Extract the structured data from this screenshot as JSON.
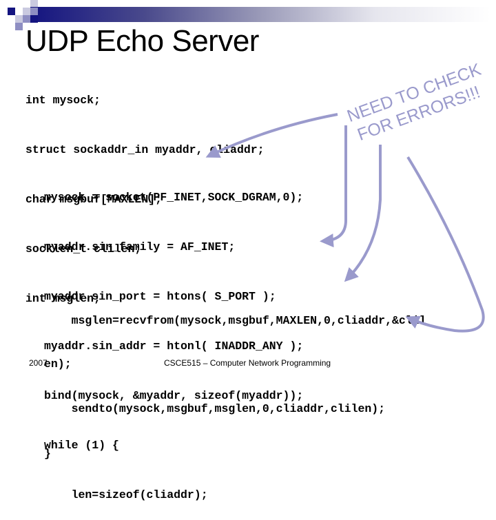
{
  "slide": {
    "title": "UDP Echo Server",
    "declarations": [
      "int mysock;",
      "struct sockaddr_in myaddr, cliaddr;",
      "char msgbuf[MAXLEN];",
      "socklen_t clilen;",
      "int msglen;"
    ],
    "code_body": [
      "mysock = socket(PF_INET,SOCK_DGRAM,0);",
      "myaddr.sin_family = AF_INET;",
      "myaddr.sin_port = htons( S_PORT );",
      "myaddr.sin_addr = htonl( INADDR_ANY );",
      "bind(mysock, &myaddr, sizeof(myaddr));",
      "while (1) {",
      "    len=sizeof(cliaddr);"
    ],
    "code_tail": [
      "    msglen=recvfrom(mysock,msgbuf,MAXLEN,0,cliaddr,&clil",
      "en);",
      "    sendto(mysock,msgbuf,msglen,0,cliaddr,clilen);",
      "}"
    ],
    "annotation": {
      "line1": "NEED TO CHECK",
      "line2": "FOR ERRORS!!!",
      "color": "#9a9acc"
    }
  },
  "footer": {
    "year": "2007",
    "course": "CSCE515 – Computer Network Programming"
  },
  "theme": {
    "accent_dark": "#141480",
    "accent_mid": "#8e8ec2",
    "accent_light": "#cacae0",
    "arrow_color": "#9a9acc"
  }
}
